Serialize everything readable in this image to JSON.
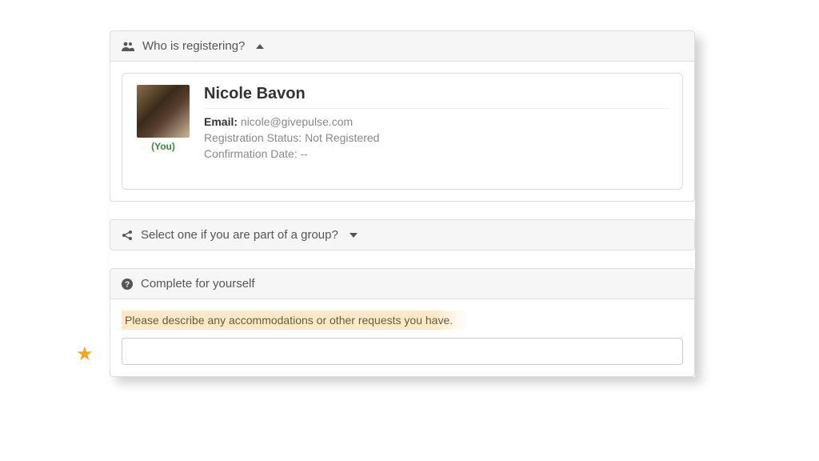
{
  "sections": {
    "who": {
      "title": "Who is registering?",
      "user": {
        "name": "Nicole Bavon",
        "you_label": "(You)",
        "email_label": "Email:",
        "email": "nicole@givepulse.com",
        "reg_status_label": "Registration Status:",
        "reg_status": "Not Registered",
        "confirm_date_label": "Confirmation Date:",
        "confirm_date": "--"
      }
    },
    "group": {
      "title": "Select one if you are part of a group?"
    },
    "yourself": {
      "title": "Complete for yourself",
      "prompt": "Please describe any accommodations or other requests you have.",
      "input_value": ""
    }
  }
}
